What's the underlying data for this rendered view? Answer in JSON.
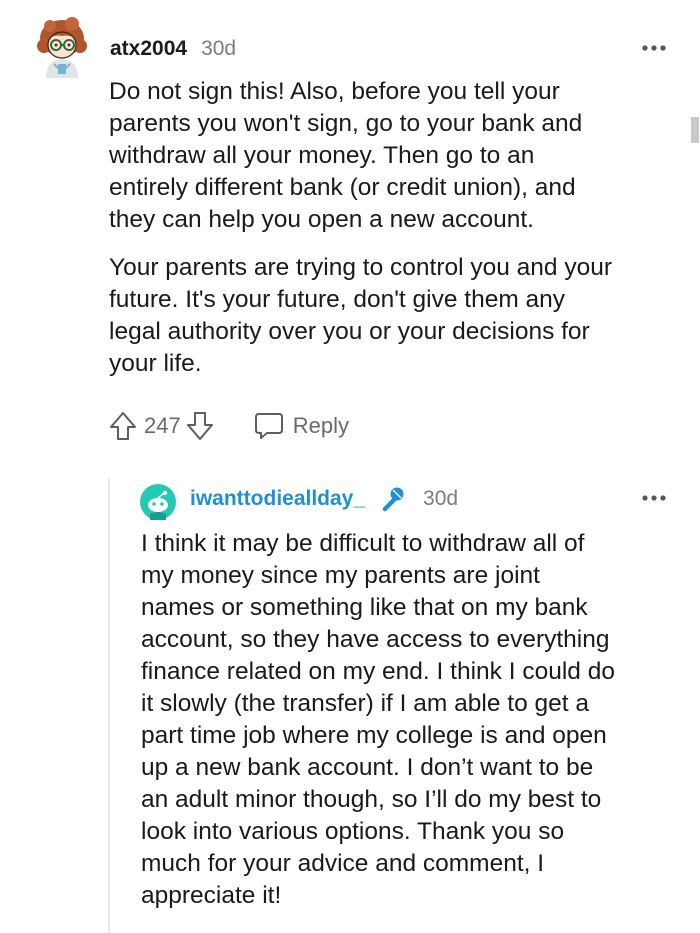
{
  "comment": {
    "username": "atx2004",
    "age": "30d",
    "paragraphs": [
      "Do not sign this! Also, before you tell your\nparents you won't sign, go to your bank and\nwithdraw all your money. Then go to an\nentirely different bank (or credit union), and\nthey can help you open a new account.",
      "Your parents are trying to control you and your\nfuture. It's your future, don't give them any\nlegal authority over you or your decisions for\nyour life."
    ],
    "vote_count": "247",
    "reply_label": "Reply",
    "icons": {
      "more": "more-horizontal-icon",
      "upvote": "upvote-arrow-icon",
      "downvote": "downvote-arrow-icon",
      "reply": "speech-bubble-icon"
    }
  },
  "reply": {
    "username": "iwanttodieallday_",
    "badge_icon": "microphone-icon",
    "age": "30d",
    "body": "I think it may be difficult to withdraw all of\nmy money since my parents are joint\nnames or something like that on my bank\naccount, so they have access to everything\nfinance related on my end. I think I could do\nit slowly (the transfer) if I am able to get a\npart time job where my college is and open\nup a new bank account. I don’t want to be\nan adult minor though, so I’ll do my best to\nlook into various options. Thank you so\nmuch for your advice and comment, I\nappreciate it!"
  },
  "colors": {
    "text": "#1c1c1c",
    "meta": "#7c7c7c",
    "action": "#6a6a6a",
    "op_username": "#1f8fd6",
    "reply_avatar_bg": "#24c9b4",
    "thread_line": "#e9e9e9"
  }
}
